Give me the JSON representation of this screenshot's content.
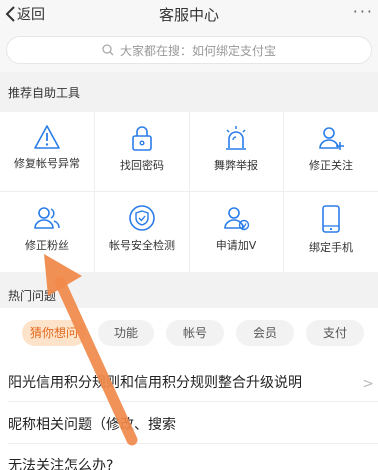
{
  "nav": {
    "back_label": "返回",
    "title": "客服中心",
    "more_icon": "more-dots-icon"
  },
  "search": {
    "placeholder": "大家都在搜：如何绑定支付宝"
  },
  "tools_section": {
    "title": "推荐自助工具",
    "items": [
      {
        "label": "修复帐号异常",
        "icon": "warning-triangle-icon"
      },
      {
        "label": "找回密码",
        "icon": "lock-icon"
      },
      {
        "label": "舞弊举报",
        "icon": "alarm-light-icon"
      },
      {
        "label": "修正关注",
        "icon": "user-add-icon"
      },
      {
        "label": "修正粉丝",
        "icon": "users-icon"
      },
      {
        "label": "帐号安全检测",
        "icon": "shield-icon"
      },
      {
        "label": "申请加V",
        "icon": "user-verified-icon"
      },
      {
        "label": "绑定手机",
        "icon": "phone-icon"
      }
    ]
  },
  "hot_section": {
    "title": "热门问题",
    "chips": [
      {
        "label": "猜你想问",
        "active": true
      },
      {
        "label": "功能",
        "active": false
      },
      {
        "label": "帐号",
        "active": false
      },
      {
        "label": "会员",
        "active": false
      },
      {
        "label": "支付",
        "active": false
      }
    ],
    "questions": [
      "阳光信用积分规则和信用积分规则整合升级说明",
      "昵称相关问题（修改、搜索",
      "无法关注怎么办?"
    ]
  },
  "colors": {
    "accent": "#e2691d",
    "icon": "#2b7de9",
    "arrow": "#f08a4b"
  }
}
